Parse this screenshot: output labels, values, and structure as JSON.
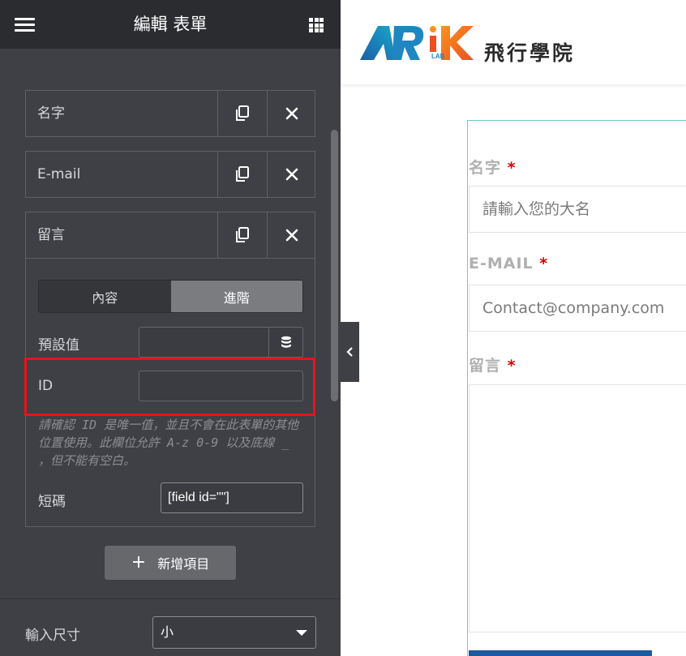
{
  "editor": {
    "title": "編輯 表單",
    "items": [
      {
        "label": "名字"
      },
      {
        "label": "E-mail"
      },
      {
        "label": "留言"
      }
    ],
    "tabs": {
      "content": "內容",
      "advanced": "進階"
    },
    "default_value_label": "預設值",
    "default_value": "",
    "id_label": "ID",
    "id_value": "",
    "help_text": "請確認 ID 是唯一值，並且不會在此表單的其他位置使用。此欄位允許 A-z 0-9 以及底線 _ ，但不能有空白。",
    "shortcode_label": "短碼",
    "shortcode_value": "[field id=\"\"]",
    "add_item_label": "新增項目",
    "input_size_label": "輸入尺寸",
    "input_size_value": "小"
  },
  "site": {
    "logo_text": "飛行學院",
    "logo_sub": "LAB"
  },
  "form": {
    "fields": [
      {
        "label": "名字",
        "required_mark": "*",
        "placeholder": "請輸入您的大名"
      },
      {
        "label": "E-MAIL",
        "required_mark": "*",
        "placeholder": "Contact@company.com"
      },
      {
        "label": "留言",
        "required_mark": "*",
        "placeholder": ""
      }
    ]
  },
  "colors": {
    "panel_bg": "#3e4045",
    "header_bg": "#2b2c30",
    "highlight": "#e6141b",
    "form_frame": "#6ec8d6",
    "required": "#d40000",
    "submit": "#1c5aa0"
  }
}
